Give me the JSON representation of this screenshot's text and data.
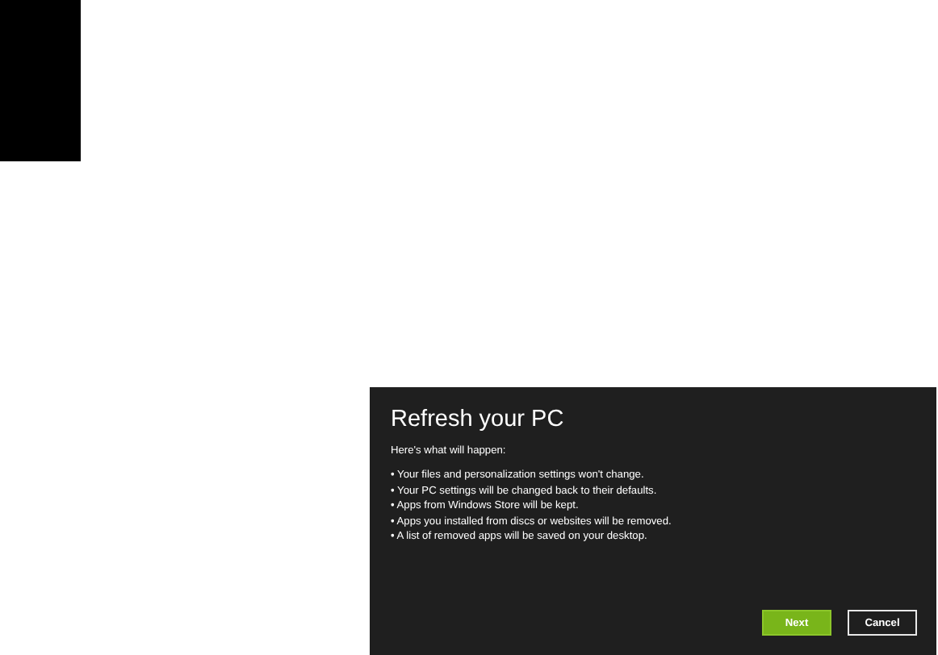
{
  "dialog": {
    "title": "Refresh your PC",
    "intro": "Here's what will happen:",
    "points": [
      "• Your files and personalization settings won't change.",
      "• Your PC settings will be changed back to their defaults.",
      "• Apps from Windows Store will be kept.",
      "• Apps you installed from discs or websites will be removed.",
      "• A list of removed apps will be saved on your desktop."
    ],
    "buttons": [
      {
        "label": "Next",
        "kind": "primary"
      },
      {
        "label": "Cancel",
        "kind": "secondary"
      }
    ]
  }
}
